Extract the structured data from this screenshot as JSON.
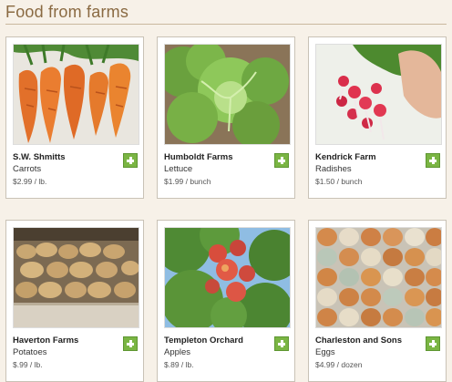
{
  "page": {
    "title": "Food from farms"
  },
  "products": [
    {
      "farm": "S.W. Shmitts",
      "product": "Carrots",
      "price": "$2.99 / lb."
    },
    {
      "farm": "Humboldt Farms",
      "product": "Lettuce",
      "price": "$1.99 / bunch"
    },
    {
      "farm": "Kendrick Farm",
      "product": "Radishes",
      "price": "$1.50 / bunch"
    },
    {
      "farm": "Haverton Farms",
      "product": "Potatoes",
      "price": "$.99 / lb."
    },
    {
      "farm": "Templeton Orchard",
      "product": "Apples",
      "price": "$.89 / lb."
    },
    {
      "farm": "Charleston and Sons",
      "product": "Eggs",
      "price": "$4.99 / dozen"
    }
  ],
  "icons": {
    "add": "plus-icon"
  },
  "colors": {
    "add_button": "#7ab543",
    "title": "#8a6a42",
    "background": "#f7f1e8"
  }
}
